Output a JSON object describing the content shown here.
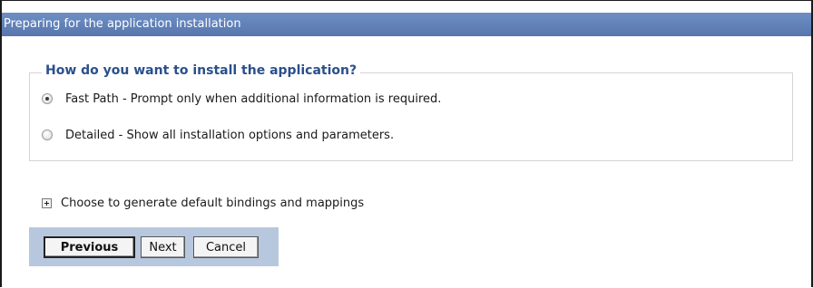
{
  "window": {
    "title": "Preparing for the application installation"
  },
  "install_options": {
    "legend": "How do you want to install the application?",
    "options": [
      {
        "label": "Fast Path - Prompt only when additional information is required.",
        "selected": true
      },
      {
        "label": "Detailed - Show all installation options and parameters.",
        "selected": false
      }
    ]
  },
  "bindings": {
    "label": "Choose to generate default bindings and mappings",
    "expanded": false
  },
  "buttons": {
    "previous": "Previous",
    "next": "Next",
    "cancel": "Cancel"
  },
  "colors": {
    "title_bar": "#5e7fb8",
    "legend_text": "#2b4f8c",
    "button_bar": "#b7c7dd"
  }
}
